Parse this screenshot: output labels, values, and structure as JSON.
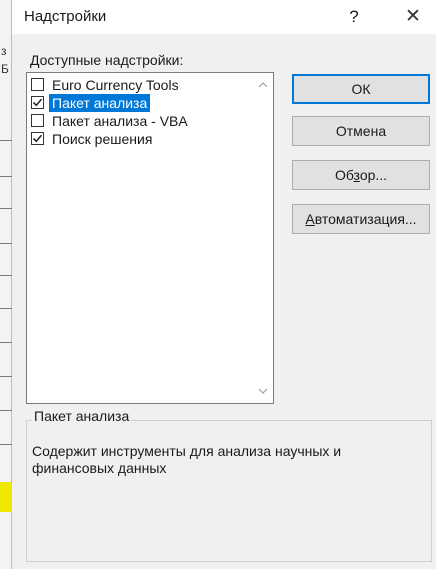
{
  "dialog": {
    "title": "Надстройки",
    "help_label": "?",
    "close_label": "✕",
    "available_label_first": "Д",
    "available_label_rest": "оступные надстройки:"
  },
  "addins": [
    {
      "label": "Euro Currency Tools",
      "checked": false,
      "selected": false
    },
    {
      "label": "Пакет анализа",
      "checked": true,
      "selected": true
    },
    {
      "label": "Пакет анализа - VBA",
      "checked": false,
      "selected": false
    },
    {
      "label": "Поиск решения",
      "checked": true,
      "selected": false
    }
  ],
  "buttons": {
    "ok": "ОК",
    "cancel": "Отмена",
    "browse_pre": "Об",
    "browse_u": "з",
    "browse_post": "ор...",
    "automation_u": "А",
    "automation_rest": "втоматизация..."
  },
  "description": {
    "title": "Пакет анализа",
    "text": "Содержит инструменты для анализа научных и финансовых данных"
  },
  "background": {
    "char_top": "з",
    "char_mid": "Б"
  },
  "colors": {
    "selection": "#0078d7",
    "dialog_bg": "#f0f0f0",
    "highlight_cell": "#f0e800"
  }
}
